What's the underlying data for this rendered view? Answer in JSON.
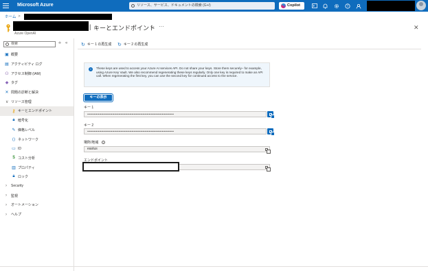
{
  "topbar": {
    "brand": "Microsoft Azure",
    "search_placeholder": "リソース、サービス、ドキュメントの検索 (G+/)",
    "copilot_label": "Copilot",
    "icons": [
      "cloud-shell-icon",
      "bell-icon",
      "gear-icon",
      "help-icon",
      "feedback-icon"
    ]
  },
  "breadcrumb": {
    "home": "ホーム",
    "separator": ">"
  },
  "header": {
    "divider": "|",
    "title": "キーとエンドポイント",
    "resource_type": "Azure OpenAI"
  },
  "sidebar": {
    "search_placeholder": "検索",
    "items": [
      {
        "label": "概要",
        "icon": "overview-icon",
        "level": 0,
        "color": "#0f6cbd"
      },
      {
        "label": "アクティビティ ログ",
        "icon": "activity-log-icon",
        "level": 0,
        "color": "#0f6cbd"
      },
      {
        "label": "アクセス制御 (IAM)",
        "icon": "iam-icon",
        "level": 0,
        "color": "#5c2d91"
      },
      {
        "label": "タグ",
        "icon": "tag-icon",
        "level": 0,
        "color": "#8764b8"
      },
      {
        "label": "問題の診断と解決",
        "icon": "diagnose-icon",
        "level": 0,
        "color": "#0f6cbd"
      },
      {
        "label": "リソース管理",
        "icon": "chevron-down-icon",
        "level": "group-open"
      },
      {
        "label": "キーとエンドポイント",
        "icon": "key-icon",
        "level": 1,
        "color": "#e8a000",
        "active": true
      },
      {
        "label": "暗号化",
        "icon": "lock-icon",
        "level": 1,
        "color": "#0f6cbd"
      },
      {
        "label": "価格レベル",
        "icon": "pricing-tier-icon",
        "level": 1,
        "color": "#0f6cbd"
      },
      {
        "label": "ネットワーク",
        "icon": "network-icon",
        "level": 1,
        "color": "#0f6cbd"
      },
      {
        "label": "ID",
        "icon": "identity-icon",
        "level": 1,
        "color": "#0f6cbd"
      },
      {
        "label": "コスト分析",
        "icon": "cost-analysis-icon",
        "level": 1,
        "color": "#107c10"
      },
      {
        "label": "プロパティ",
        "icon": "properties-icon",
        "level": 1,
        "color": "#0f6cbd"
      },
      {
        "label": "ロック",
        "icon": "lock-icon",
        "level": 1,
        "color": "#0f6cbd"
      },
      {
        "label": "Security",
        "icon": "chevron-right-icon",
        "level": "group"
      },
      {
        "label": "監視",
        "icon": "chevron-right-icon",
        "level": "group"
      },
      {
        "label": "オートメーション",
        "icon": "chevron-right-icon",
        "level": "group"
      },
      {
        "label": "ヘルプ",
        "icon": "chevron-right-icon",
        "level": "group"
      }
    ]
  },
  "commands": {
    "regen_key1": "キー 1 の再生成",
    "regen_key2": "キー 2 の再生成"
  },
  "info": {
    "text": "These keys are used to access your Azure AI services API. Do not share your keys. Store them securely– for example, using Azure Key Vault. We also recommend regenerating these keys regularly. Only one key is required to make an API call. When regenerating the first key, you can use the second key for continued access to the service."
  },
  "show_keys_label": "キーの表示",
  "fields": {
    "key1_label": "キー 1",
    "key1_value": "••••••••••••••••••••••••••••••••••••••••••••••••••••••••••••••••••••••••••••••••",
    "key2_label": "キー 2",
    "key2_value": "••••••••••••••••••••••••••••••••••••••••••••••••••••••••••••••••••••••••••••••••",
    "location_label": "場所/地域",
    "location_value": "eastus",
    "endpoint_label": "エンドポイント",
    "endpoint_value": ""
  },
  "colors": {
    "brand_blue": "#0f6cbd",
    "key_icon": "#e8a000"
  }
}
